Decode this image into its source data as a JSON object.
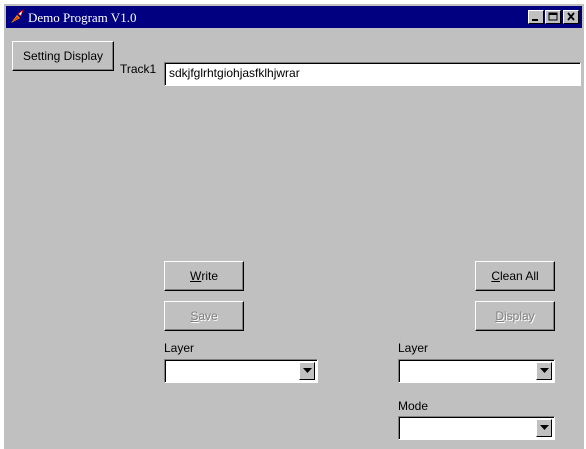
{
  "window": {
    "title": "Demo Program V1.0",
    "app_icon": "flame-rocket-icon"
  },
  "toolbar": {
    "setting_display_label": "Setting Display"
  },
  "track": {
    "label": "Track1",
    "value": "sdkjfglrhtgiohjasfklhjwrar"
  },
  "buttons": {
    "write": {
      "mnemonic": "W",
      "rest": "rite",
      "enabled": true
    },
    "save": {
      "mnemonic": "S",
      "rest": "ave",
      "enabled": false
    },
    "clean_all": {
      "mnemonic": "C",
      "rest": "lean All",
      "enabled": true
    },
    "display": {
      "mnemonic": "D",
      "rest": "isplay",
      "enabled": false
    }
  },
  "left_panel": {
    "layer_label": "Layer",
    "layer_value": ""
  },
  "right_panel": {
    "layer_label": "Layer",
    "layer_value": "",
    "mode_label": "Mode",
    "mode_value": ""
  },
  "colors": {
    "titlebar": "#000080",
    "face": "#c0c0c0",
    "disabled_text": "#808080"
  }
}
